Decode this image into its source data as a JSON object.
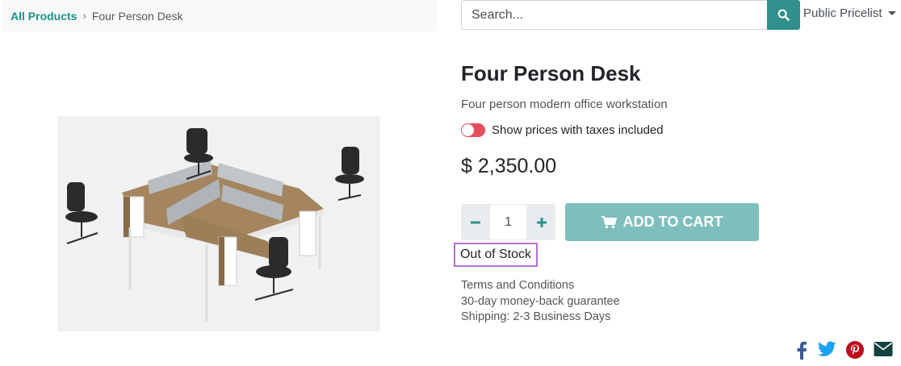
{
  "breadcrumb": {
    "parent": "All Products",
    "separator": "›",
    "current": "Four Person Desk"
  },
  "search": {
    "placeholder": "Search...",
    "icon": "search-icon"
  },
  "pricelist": {
    "label": "Public Pricelist"
  },
  "product": {
    "name": "Four Person Desk",
    "description": "Four person modern office workstation",
    "tax_toggle_label": "Show prices with taxes included",
    "price": "$ 2,350.00",
    "quantity": "1",
    "add_to_cart_label": "ADD TO CART",
    "stock_status": "Out of Stock",
    "terms": [
      "Terms and Conditions",
      "30-day money-back guarantee",
      "Shipping: 2-3 Business Days"
    ]
  },
  "social": [
    "facebook-icon",
    "twitter-icon",
    "pinterest-icon",
    "email-icon"
  ],
  "colors": {
    "accent": "#31908b",
    "cart_button": "#7ebfbd",
    "toggle": "#e44d5e",
    "highlight": "#b86fd0"
  }
}
